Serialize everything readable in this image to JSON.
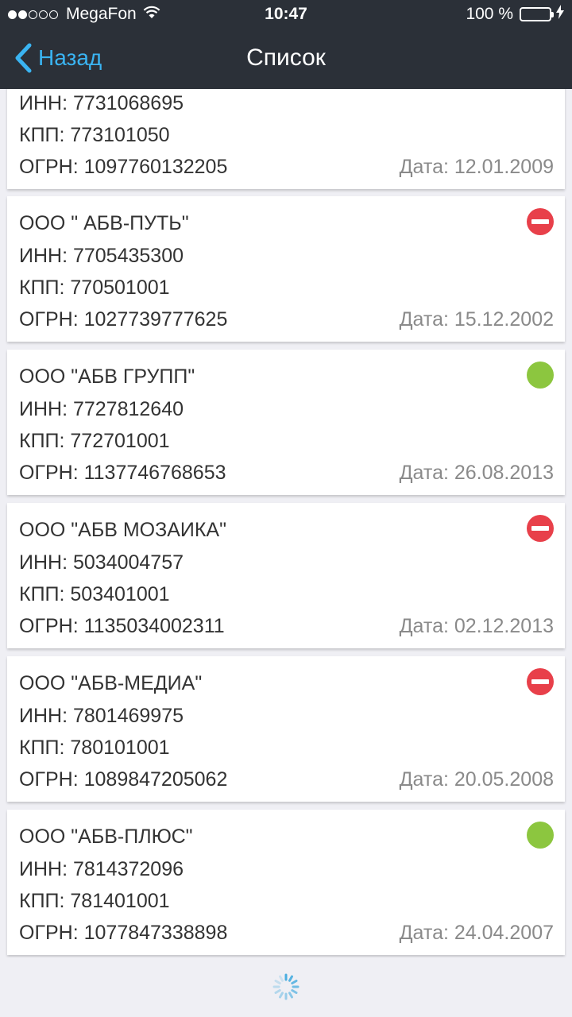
{
  "status_bar": {
    "carrier": "MegaFon",
    "time": "10:47",
    "battery": "100 %"
  },
  "nav": {
    "back_label": "Назад",
    "title": "Список"
  },
  "colors": {
    "nav_bg": "#2b3038",
    "accent": "#3ab4f2",
    "active": "#8cc63f",
    "liquidated": "#e8404a"
  },
  "first_card": {
    "inn": "ИНН: 7731068695",
    "kpp": "КПП: 773101050",
    "ogrn": "ОГРН: 1097760132205",
    "date": "Дата: 12.01.2009"
  },
  "cards": [
    {
      "name": "ООО \" АБВ-ПУТЬ\"",
      "inn": "ИНН: 7705435300",
      "kpp": "КПП: 770501001",
      "ogrn": "ОГРН: 1027739777625",
      "date": "Дата: 15.12.2002",
      "status": "liquidated"
    },
    {
      "name": "ООО \"АБВ ГРУПП\"",
      "inn": "ИНН: 7727812640",
      "kpp": "КПП: 772701001",
      "ogrn": "ОГРН: 1137746768653",
      "date": "Дата: 26.08.2013",
      "status": "active"
    },
    {
      "name": "ООО \"АБВ МОЗАИКА\"",
      "inn": "ИНН: 5034004757",
      "kpp": "КПП: 503401001",
      "ogrn": "ОГРН: 1135034002311",
      "date": "Дата: 02.12.2013",
      "status": "liquidated"
    },
    {
      "name": "ООО \"АБВ-МЕДИА\"",
      "inn": "ИНН: 7801469975",
      "kpp": "КПП: 780101001",
      "ogrn": "ОГРН: 1089847205062",
      "date": "Дата: 20.05.2008",
      "status": "liquidated"
    },
    {
      "name": "ООО \"АБВ-ПЛЮС\"",
      "inn": "ИНН: 7814372096",
      "kpp": "КПП: 781401001",
      "ogrn": "ОГРН: 1077847338898",
      "date": "Дата: 24.04.2007",
      "status": "active"
    }
  ],
  "icons": {
    "back": "chevron-left-icon",
    "wifi": "wifi-icon",
    "battery": "battery-icon",
    "charging": "bolt-icon",
    "active": "status-active-icon",
    "liquidated": "status-liquidated-icon",
    "loading": "loading-spinner-icon"
  }
}
